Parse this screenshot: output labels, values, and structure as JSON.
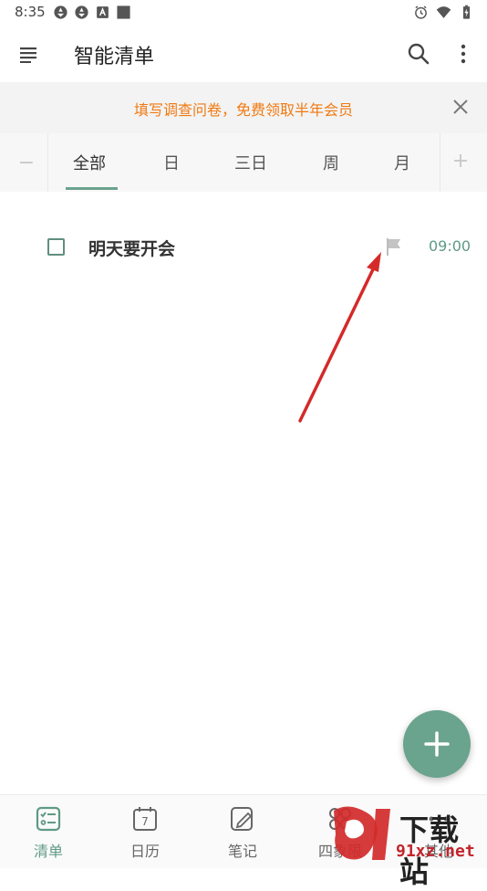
{
  "status_bar": {
    "time": "8:35",
    "left_icons": [
      "app-notification-icon",
      "app-notification-icon",
      "font-a-icon",
      "square-icon"
    ],
    "right_icons": [
      "alarm-icon",
      "wifi-icon",
      "battery-charging-icon"
    ]
  },
  "app_bar": {
    "title": "智能清单",
    "icons": [
      "menu-icon",
      "search-icon",
      "more-vert-icon"
    ]
  },
  "banner": {
    "text": "填写调查问卷，免费领取半年会员",
    "text_color": "#f07a12"
  },
  "tabs": {
    "minus_label": "−",
    "plus_label": "+",
    "items": [
      {
        "label": "全部",
        "active": true
      },
      {
        "label": "日",
        "active": false
      },
      {
        "label": "三日",
        "active": false
      },
      {
        "label": "周",
        "active": false
      },
      {
        "label": "月",
        "active": false
      }
    ],
    "accent": "#6aa38e"
  },
  "tasks": [
    {
      "title": "明天要开会",
      "time": "09:00",
      "checked": false,
      "flag_icon": "flag-icon"
    }
  ],
  "fab": {
    "icon": "plus-icon",
    "color": "#6aa38e"
  },
  "bottom_nav": {
    "items": [
      {
        "label": "清单",
        "icon": "checklist-icon",
        "active": true
      },
      {
        "label": "日历",
        "icon": "calendar-icon",
        "active": false,
        "icon_text": "7"
      },
      {
        "label": "笔记",
        "icon": "note-edit-icon",
        "active": false
      },
      {
        "label": "四象限",
        "icon": "quadrant-icon",
        "active": false
      },
      {
        "label": "其他",
        "icon": "more-icon",
        "active": false
      }
    ]
  },
  "watermark": {
    "top_text": "下载站",
    "bottom_text": "91xz.net"
  }
}
